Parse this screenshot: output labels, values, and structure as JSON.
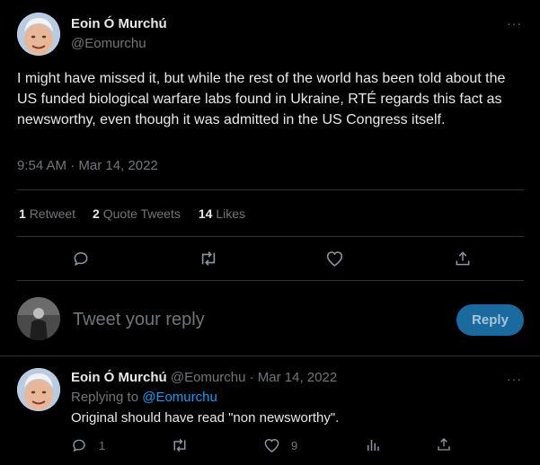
{
  "main_tweet": {
    "author_name": "Eoin Ó Murchú",
    "handle": "@Eomurchu",
    "text": "I might have missed it, but while the rest of the world has been told about the US funded biological warfare labs found in Ukraine, RTÉ regards this fact as newsworthy, even though it was admitted in the US Congress itself.",
    "timestamp": "9:54 AM · Mar 14, 2022",
    "stats": {
      "retweets_count": "1",
      "retweets_label": "Retweet",
      "quotes_count": "2",
      "quotes_label": "Quote Tweets",
      "likes_count": "14",
      "likes_label": "Likes"
    },
    "more_glyph": "···"
  },
  "composer": {
    "placeholder": "Tweet your reply",
    "button_label": "Reply"
  },
  "reply_tweet": {
    "author_name": "Eoin Ó Murchú",
    "handle": "@Eomurchu",
    "separator": "·",
    "date": "Mar 14, 2022",
    "replying_to_label": "Replying to",
    "replying_to_handle": "@Eomurchu",
    "text": "Original should have read \"non newsworthy\".",
    "reply_count": "1",
    "like_count": "9",
    "more_glyph": "···"
  },
  "colors": {
    "background": "#000000",
    "text": "#e7e9ea",
    "muted": "#71767b",
    "accent": "#1d9bf0",
    "divider": "#2f3336"
  },
  "icons": [
    "reply-icon",
    "retweet-icon",
    "like-icon",
    "share-icon",
    "analytics-icon",
    "more-icon"
  ]
}
